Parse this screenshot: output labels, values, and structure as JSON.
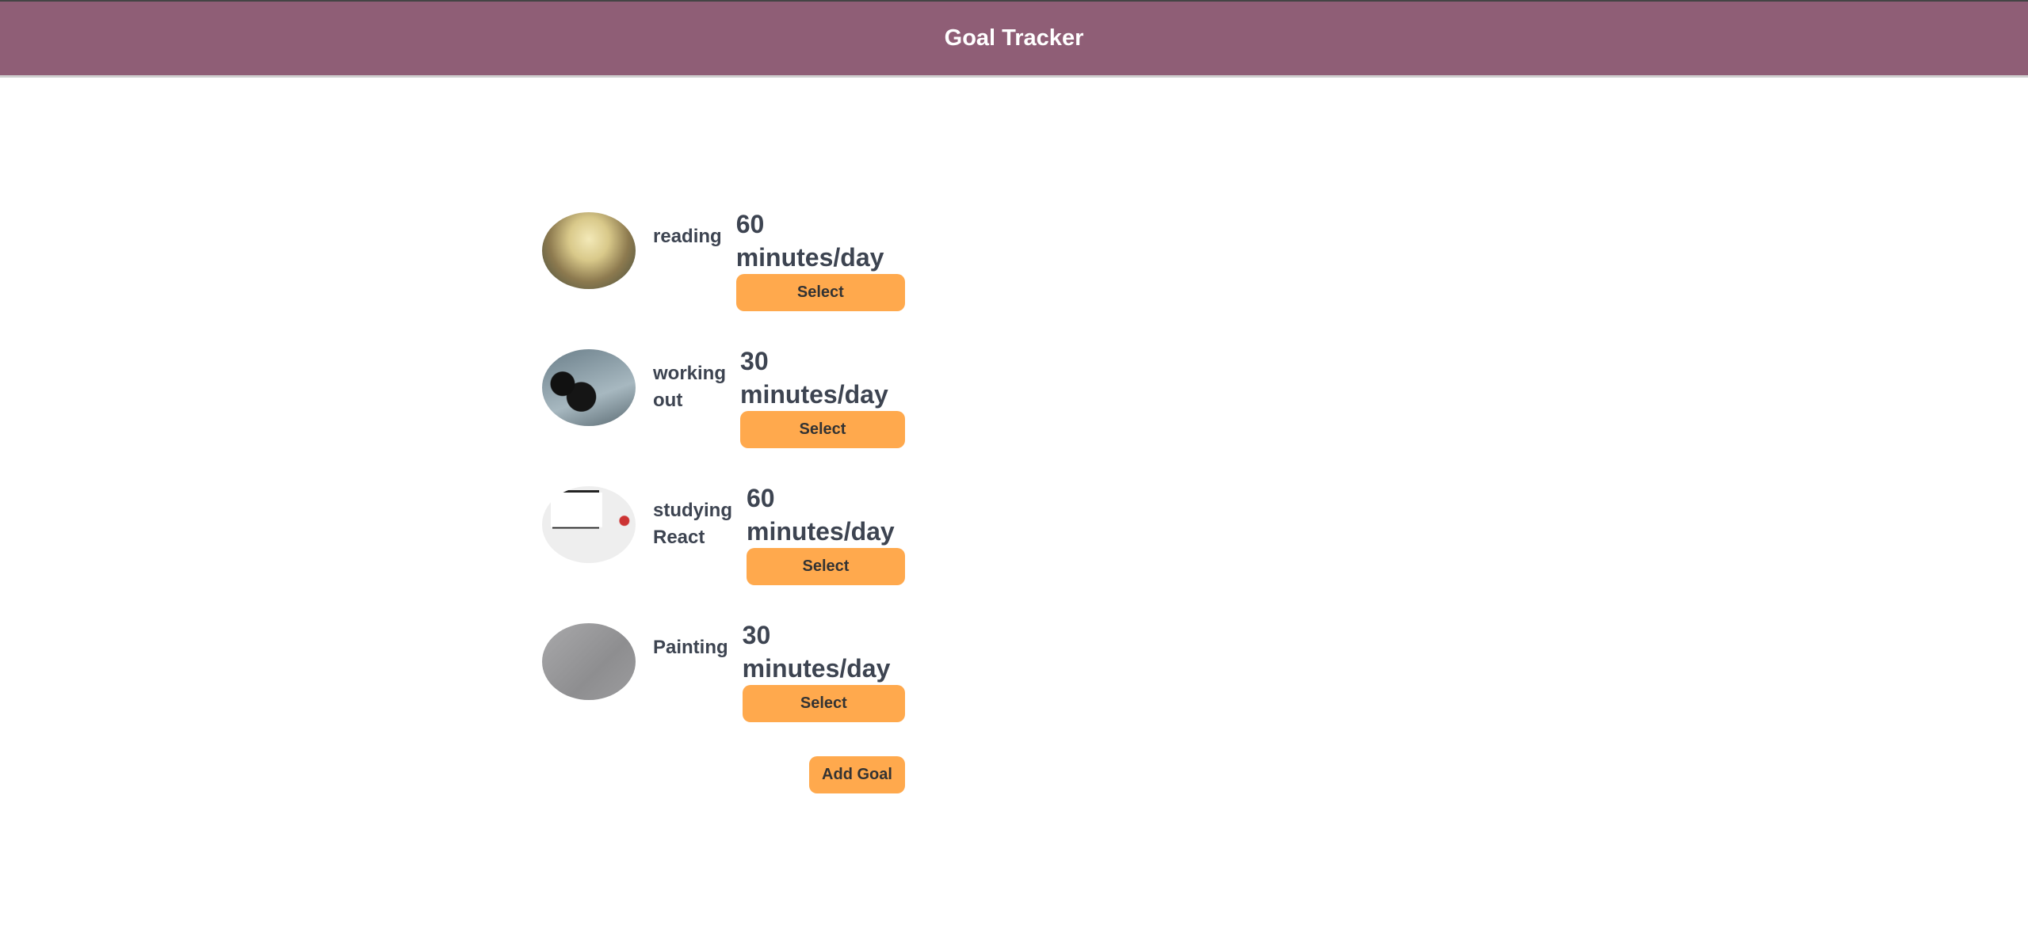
{
  "header": {
    "title": "Goal Tracker"
  },
  "goals": [
    {
      "name": "reading",
      "amount": "60 minutes/day",
      "select_label": "Select",
      "image": "open-book-photo"
    },
    {
      "name": "working out",
      "amount": "30 minutes/day",
      "select_label": "Select",
      "image": "barbell-photo"
    },
    {
      "name": "studying React",
      "amount": "60 minutes/day",
      "select_label": "Select",
      "image": "laptop-photo"
    },
    {
      "name": "Painting",
      "amount": "30 minutes/day",
      "select_label": "Select",
      "image": "pencil-drawing-photo"
    }
  ],
  "add_goal_label": "Add Goal",
  "colors": {
    "header": "#8f5e76",
    "button": "#ffa94d",
    "text": "#3d4451"
  }
}
